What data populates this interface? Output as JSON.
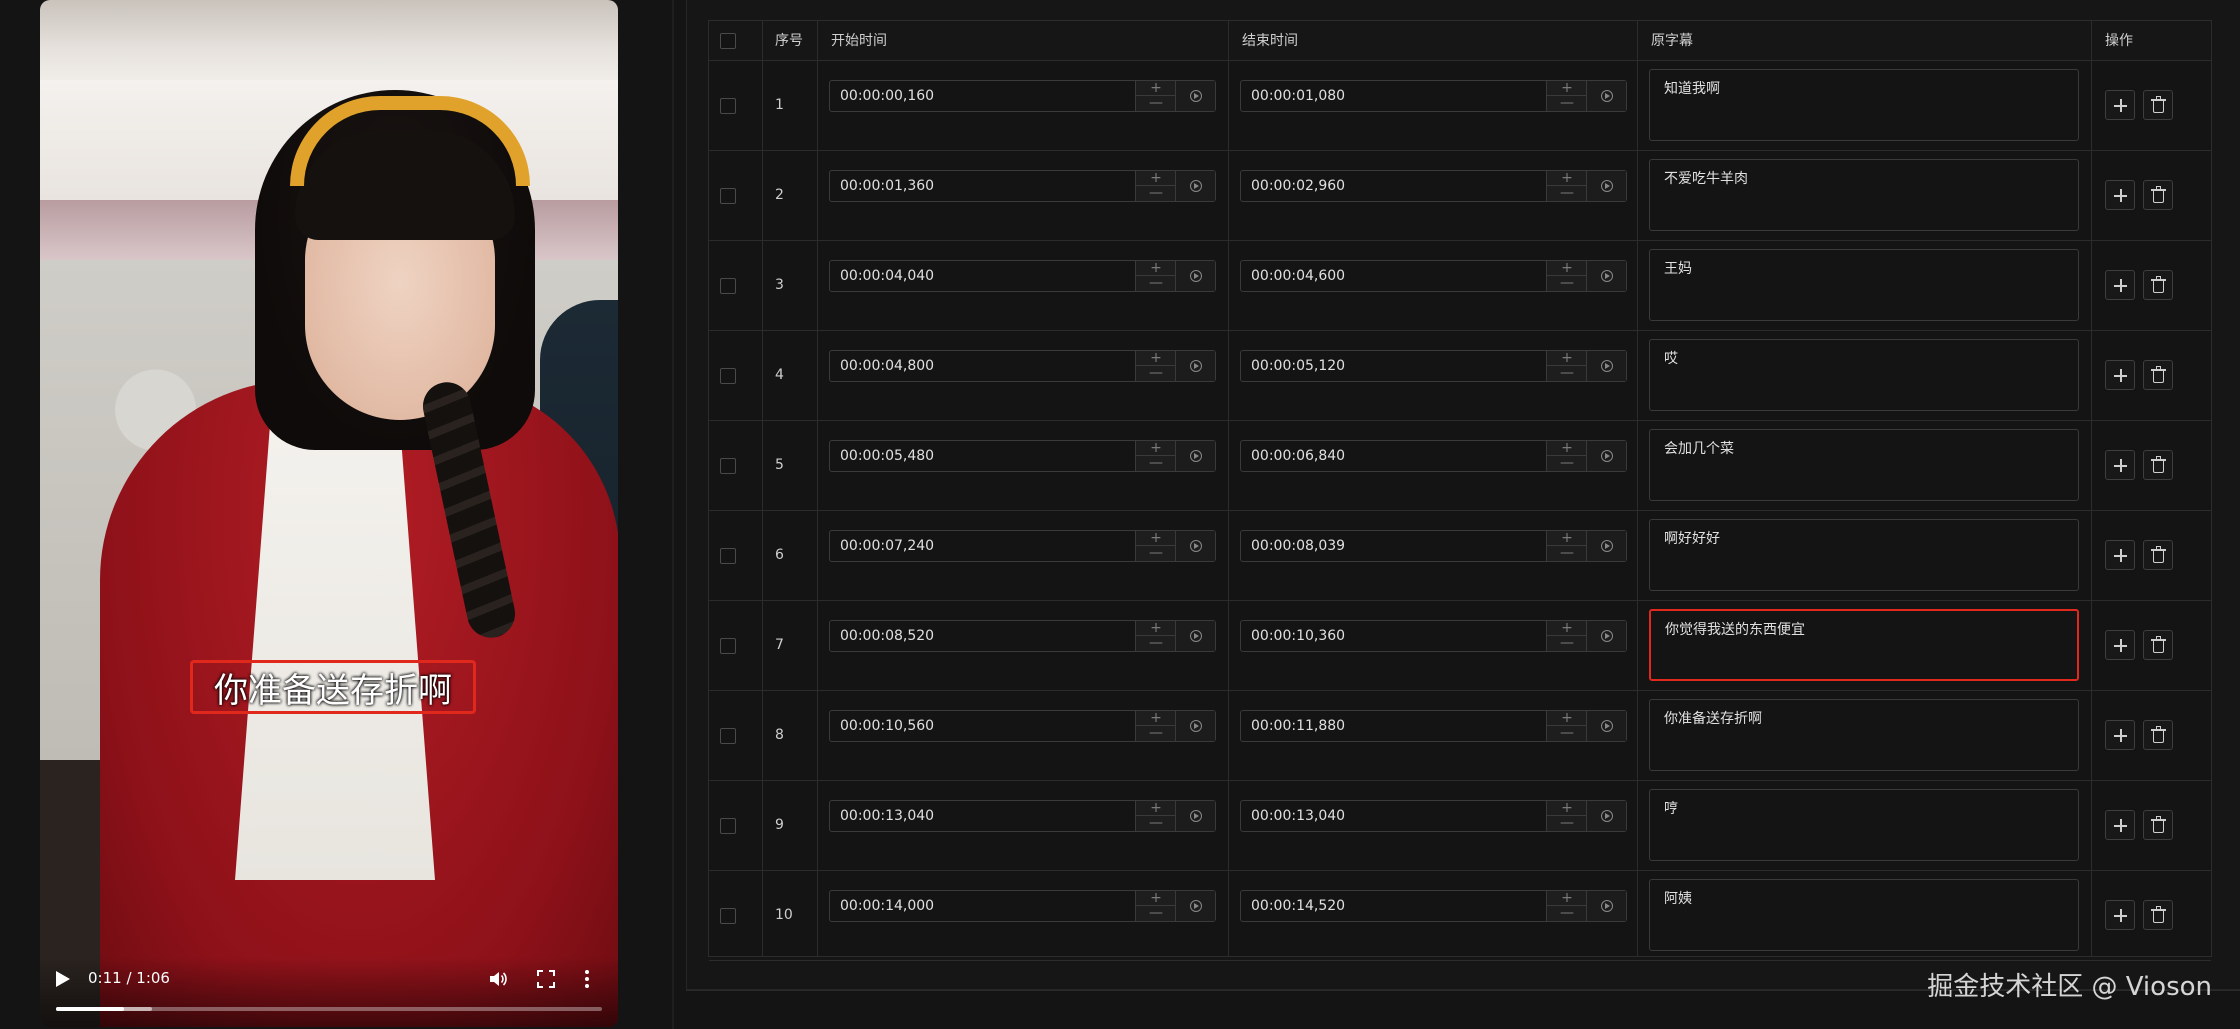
{
  "video": {
    "subtitle_overlay": "你准备送存折啊",
    "time_display": "0:11 / 1:06",
    "progress": 0.125,
    "buffered": 0.175
  },
  "table": {
    "headers": {
      "select": "",
      "index": "序号",
      "start": "开始时间",
      "end": "结束时间",
      "subtitle": "原字幕",
      "actions": "操作"
    },
    "stepper": {
      "up": "+",
      "down": "—"
    },
    "rows": [
      {
        "index": "1",
        "start": "00:00:00,160",
        "end": "00:00:01,080",
        "text": "知道我啊"
      },
      {
        "index": "2",
        "start": "00:00:01,360",
        "end": "00:00:02,960",
        "text": "不爱吃牛羊肉"
      },
      {
        "index": "3",
        "start": "00:00:04,040",
        "end": "00:00:04,600",
        "text": "王妈"
      },
      {
        "index": "4",
        "start": "00:00:04,800",
        "end": "00:00:05,120",
        "text": "哎"
      },
      {
        "index": "5",
        "start": "00:00:05,480",
        "end": "00:00:06,840",
        "text": "会加几个菜"
      },
      {
        "index": "6",
        "start": "00:00:07,240",
        "end": "00:00:08,039",
        "text": "啊好好好"
      },
      {
        "index": "7",
        "start": "00:00:08,520",
        "end": "00:00:10,360",
        "text": "你觉得我送的东西便宜"
      },
      {
        "index": "8",
        "start": "00:00:10,560",
        "end": "00:00:11,880",
        "text": "你准备送存折啊"
      },
      {
        "index": "9",
        "start": "00:00:13,040",
        "end": "00:00:13,040",
        "text": "哼"
      },
      {
        "index": "10",
        "start": "00:00:14,000",
        "end": "00:00:14,520",
        "text": "阿姨"
      }
    ],
    "active_row": 7
  },
  "watermark": "掘金技术社区 @ Vioson",
  "colors": {
    "accent_red": "#e0281c",
    "background": "#141414"
  },
  "icons": [
    "play-icon",
    "volume-icon",
    "fullscreen-icon",
    "more-icon",
    "plus-icon",
    "trash-icon",
    "play-circle-icon"
  ]
}
